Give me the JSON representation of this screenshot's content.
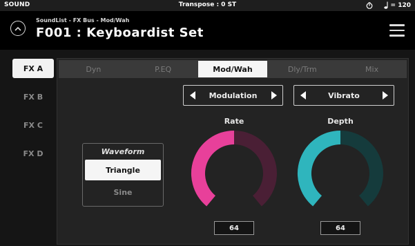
{
  "status_bar": {
    "mode": "SOUND",
    "transpose": "Transpose : 0 ST",
    "tempo": "= 120",
    "icons": {
      "metronome": "metronome-icon",
      "note": "quarter-note-icon"
    }
  },
  "header": {
    "breadcrumb": "SoundList - FX Bus - Mod/Wah",
    "title": "F001 : Keyboardist Set"
  },
  "fx_list": [
    {
      "label": "FX A",
      "active": true
    },
    {
      "label": "FX B",
      "active": false
    },
    {
      "label": "FX C",
      "active": false
    },
    {
      "label": "FX D",
      "active": false
    }
  ],
  "tabs": [
    {
      "label": "Dyn",
      "active": false
    },
    {
      "label": "P.EQ",
      "active": false
    },
    {
      "label": "Mod/Wah",
      "active": true
    },
    {
      "label": "Dly/Trm",
      "active": false
    },
    {
      "label": "Mix",
      "active": false
    }
  ],
  "selectors": {
    "type": {
      "value": "Modulation"
    },
    "subtype": {
      "value": "Vibrato"
    }
  },
  "waveform": {
    "title": "Waveform",
    "options": [
      "Triangle",
      "Sine"
    ],
    "selected": "Triangle"
  },
  "knobs": {
    "rate": {
      "label": "Rate",
      "value": "64",
      "level": 0.5,
      "color": "#e8409a",
      "track": "#4a1f35"
    },
    "depth": {
      "label": "Depth",
      "value": "64",
      "level": 0.5,
      "color": "#2fb5bd",
      "track": "#153b3c"
    }
  }
}
